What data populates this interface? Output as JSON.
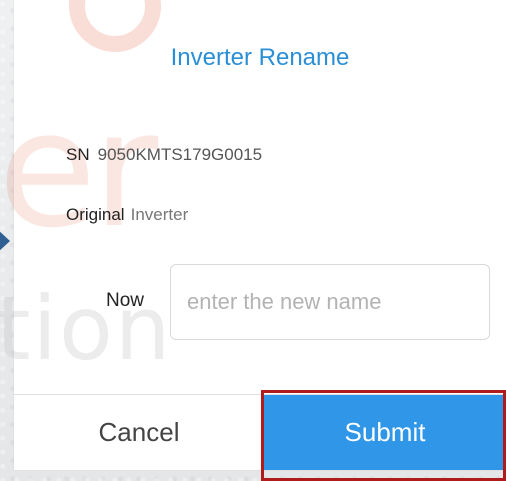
{
  "dialog": {
    "title": "Inverter Rename",
    "sn_label": "SN",
    "sn_value": "9050KMTS179G0015",
    "original_label": "Original",
    "original_value": "Inverter",
    "now_label": "Now",
    "now_input": {
      "value": "",
      "placeholder": "enter the new name"
    },
    "cancel_label": "Cancel",
    "submit_label": "Submit"
  },
  "colors": {
    "accent": "#2f96e8",
    "title": "#2b8fd6",
    "highlight": "#b01c1c",
    "arrow": "#2f5f93"
  },
  "icons": {
    "arrow": "arrow-right-icon"
  }
}
